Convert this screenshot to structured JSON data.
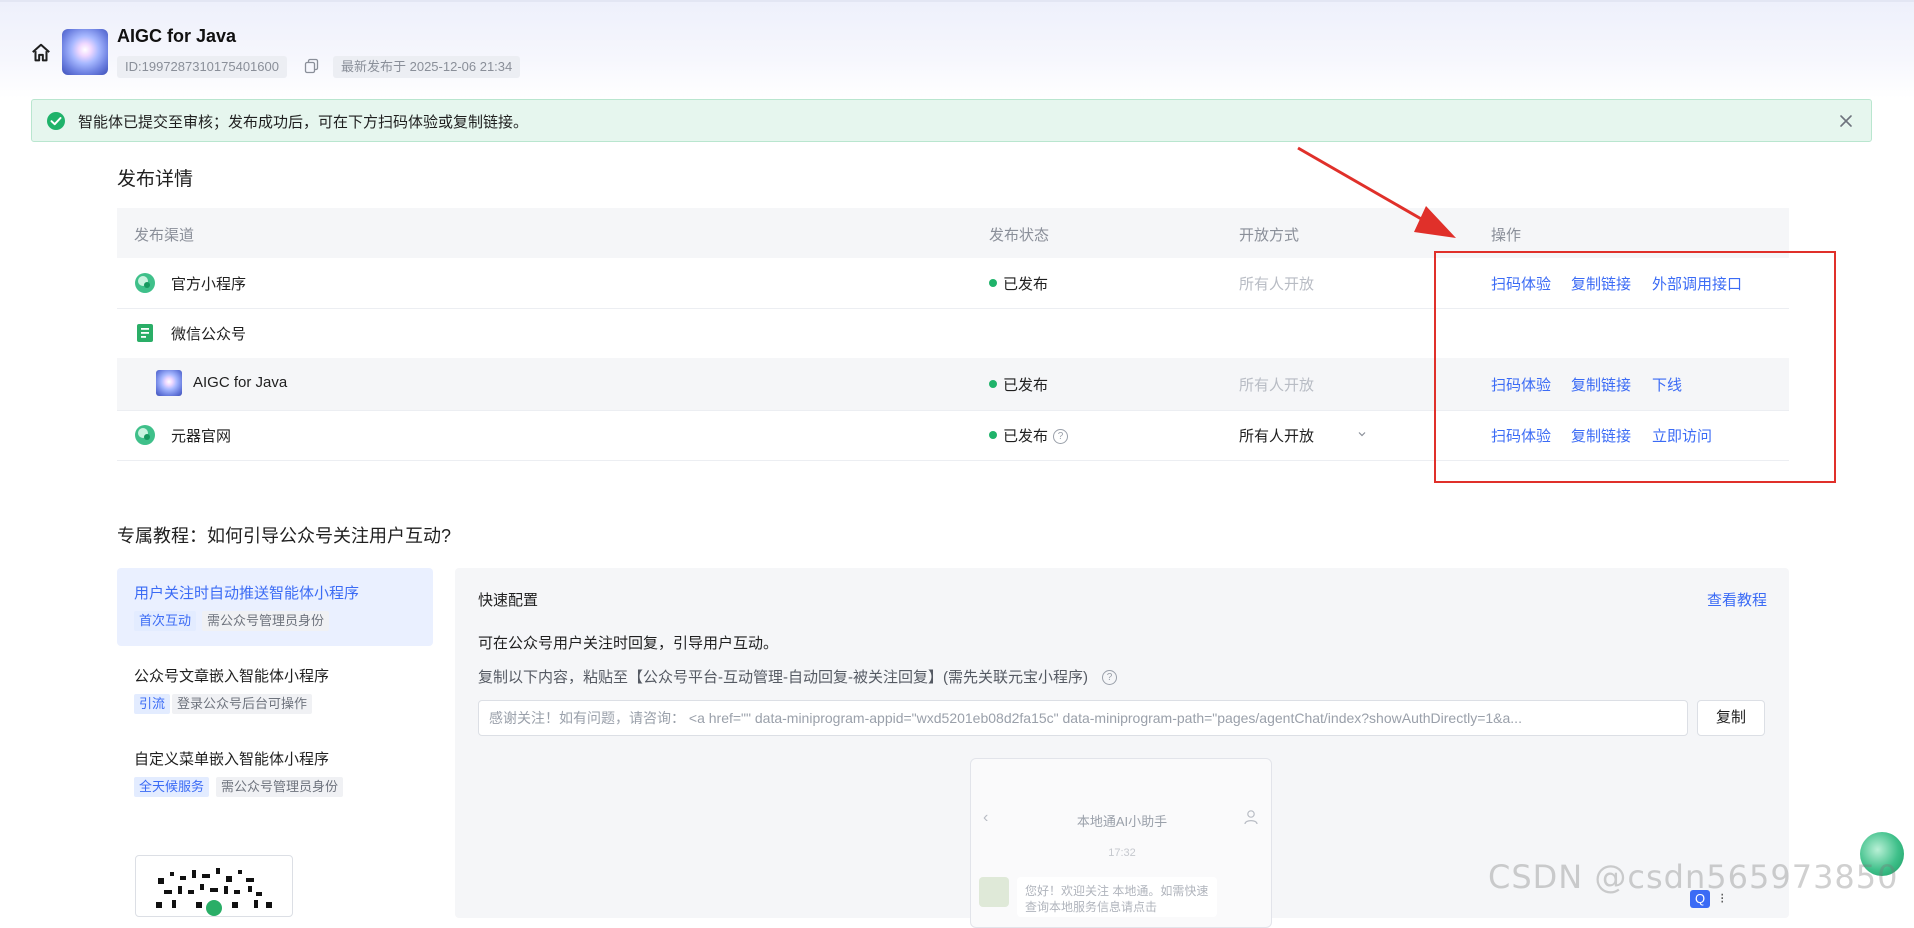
{
  "header": {
    "app_title": "AIGC for Java",
    "id_label": "ID:1997287310175401600",
    "published_label": "最新发布于 2025-12-06 21:34"
  },
  "banner": {
    "message": "智能体已提交至审核；发布成功后，可在下方扫码体验或复制链接。"
  },
  "publish": {
    "section_title": "发布详情",
    "columns": [
      "发布渠道",
      "发布状态",
      "开放方式",
      "操作"
    ],
    "rows": [
      {
        "channel": "官方小程序",
        "status": "已发布",
        "open_mode": "所有人开放",
        "actions": [
          "扫码体验",
          "复制链接",
          "外部调用接口"
        ]
      },
      {
        "channel": "微信公众号",
        "status": "",
        "open_mode": "",
        "actions": []
      },
      {
        "channel": "AIGC for Java",
        "status": "已发布",
        "open_mode": "所有人开放",
        "actions": [
          "扫码体验",
          "复制链接",
          "下线"
        ]
      },
      {
        "channel": "元器官网",
        "status": "已发布",
        "open_mode": "所有人开放",
        "actions": [
          "扫码体验",
          "复制链接",
          "立即访问"
        ]
      }
    ]
  },
  "tutorial": {
    "title": "专属教程：如何引导公众号关注用户互动?",
    "items": [
      {
        "title": "用户关注时自动推送智能体小程序",
        "tags": [
          "首次互动",
          "需公众号管理员身份"
        ]
      },
      {
        "title": "公众号文章嵌入智能体小程序",
        "tags": [
          "引流",
          "登录公众号后台可操作"
        ]
      },
      {
        "title": "自定义菜单嵌入智能体小程序",
        "tags": [
          "全天候服务",
          "需公众号管理员身份"
        ]
      }
    ]
  },
  "config": {
    "title": "快速配置",
    "tutorial_link": "查看教程",
    "description": "可在公众号用户关注时回复，引导用户互动。",
    "instruction": "复制以下内容，粘贴至【公众号平台-互动管理-自动回复-被关注回复】(需先关联元宝小程序)",
    "snippet": "感谢关注！如有问题，请咨询： <a href=\"\" data-miniprogram-appid=\"wxd5201eb08d2fa15c\" data-miniprogram-path=\"pages/agentChat/index?showAuthDirectly=1&a...",
    "copy_label": "复制",
    "preview": {
      "title": "本地通AI小助手",
      "time": "17:32",
      "message": "您好！欢迎关注 本地通。如需快速查询本地服务信息请点击"
    }
  },
  "watermark": "CSDN @csdn565973850",
  "colors": {
    "link": "#3b6bf5",
    "success": "#1fb36a",
    "annotation": "#e0302a"
  }
}
